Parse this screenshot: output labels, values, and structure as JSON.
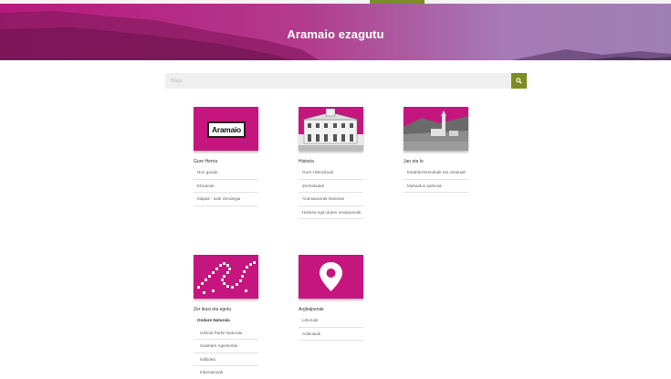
{
  "hero": {
    "title": "Aramaio ezagutu"
  },
  "search": {
    "placeholder": "Bilatu"
  },
  "cards": [
    {
      "title": "Gure Herria",
      "image_text": "Aramaio",
      "links": [
        "Non gaude",
        "Elizateak",
        "Mapak - kale izendegia"
      ]
    },
    {
      "title": "Historia",
      "links": [
        "Gure Historikoak",
        "Zertzeladak",
        "Aramaioarrak historian",
        "Historia egin duten emakumeak"
      ]
    },
    {
      "title": "Jan eta lo",
      "links": [
        "Establezimenduak eta ostatuak",
        "Mahaidun parkeak"
      ]
    },
    {
      "title": "Zer ikusi eta egotu",
      "links": [
        "Ondare Naturala",
        "Urkiola Parke Naturala",
        "Saiobarri Agestorlak",
        "Isilbidea",
        "Inbentarioak"
      ]
    },
    {
      "title": "Argitalpenak",
      "links": [
        "Liburuak",
        "Artikuluak"
      ]
    }
  ],
  "colors": {
    "brand_magenta": "#c5157e",
    "accent_green": "#7d8d22"
  },
  "icons": {
    "search": "search-icon",
    "location": "map-pin-icon"
  }
}
